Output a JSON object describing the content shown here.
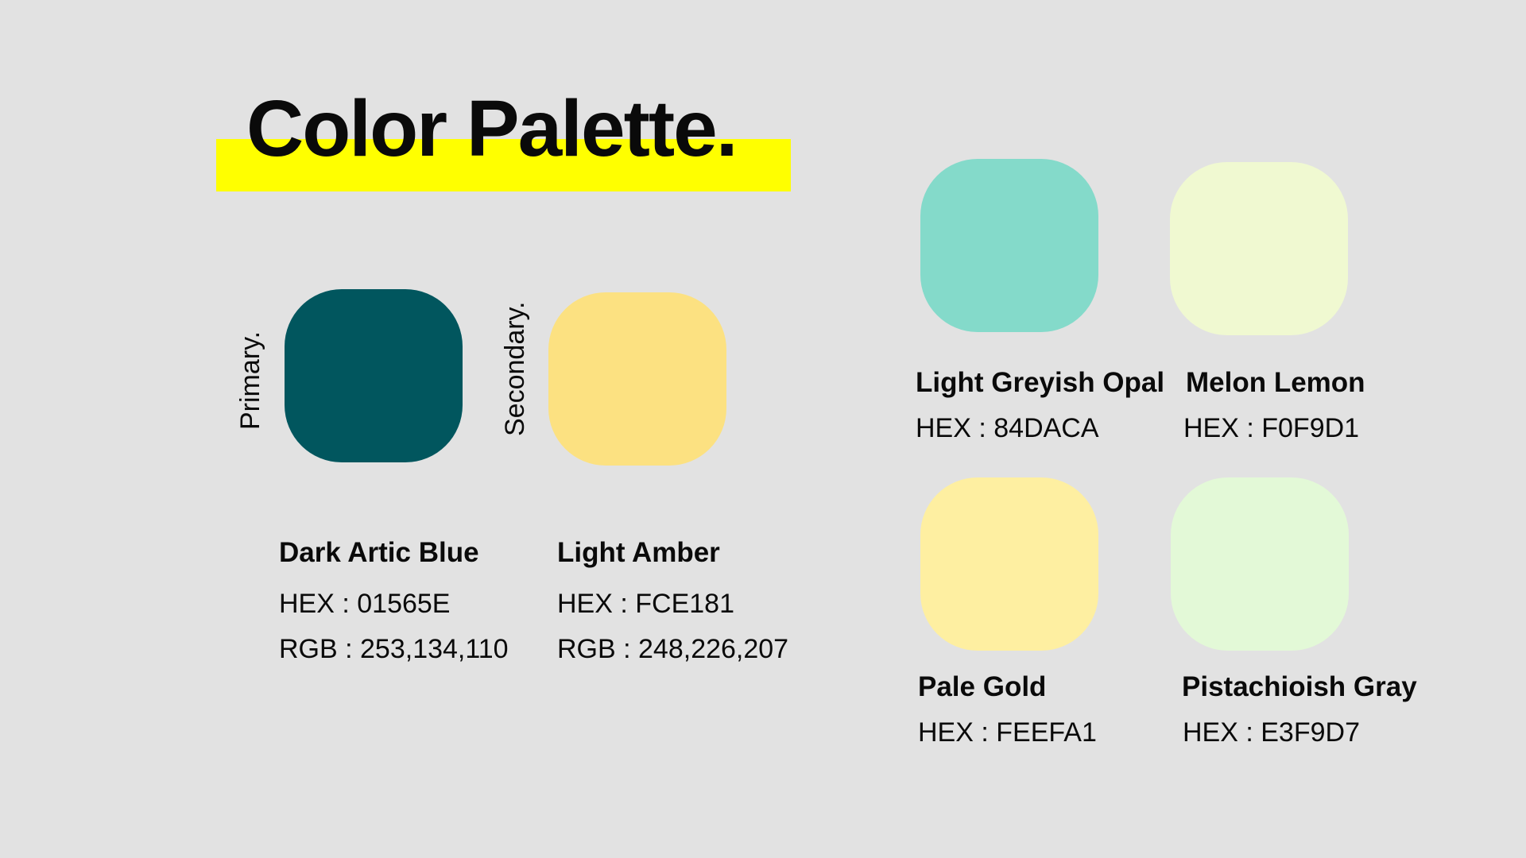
{
  "title": "Color Palette.",
  "colors": {
    "highlight": "#ffff00",
    "background": "#e2e2e2"
  },
  "primary": {
    "label": "Primary.",
    "name": "Dark Artic Blue",
    "hex_text": "HEX : 01565E",
    "rgb_text": "RGB : 253,134,110",
    "swatch_color": "#01565E"
  },
  "secondary": {
    "label": "Secondary.",
    "name": "Light Amber",
    "hex_text": "HEX : FCE181",
    "rgb_text": "RGB : 248,226,207",
    "swatch_color": "#FCE181"
  },
  "palette": [
    {
      "name": "Light Greyish Opal",
      "hex_text": "HEX : 84DACA",
      "swatch_color": "#84DACA"
    },
    {
      "name": "Melon Lemon",
      "hex_text": "HEX : F0F9D1",
      "swatch_color": "#F0F9D1"
    },
    {
      "name": "Pale Gold",
      "hex_text": "HEX : FEEFA1",
      "swatch_color": "#FEEFA1"
    },
    {
      "name": "Pistachioish Gray",
      "hex_text": "HEX : E3F9D7",
      "swatch_color": "#E3F9D7"
    }
  ]
}
